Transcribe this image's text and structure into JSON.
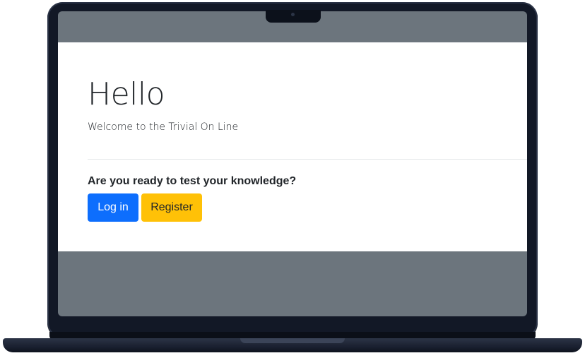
{
  "jumbotron": {
    "title": "Hello",
    "subtitle": "Welcome to the Trivial On Line"
  },
  "cta": {
    "prompt": "Are you ready to test your knowledge?",
    "login_label": "Log in",
    "register_label": "Register"
  },
  "colors": {
    "primary": "#0d6efd",
    "warning": "#ffc107",
    "page_background": "#6c757d",
    "frame": "#121826"
  }
}
